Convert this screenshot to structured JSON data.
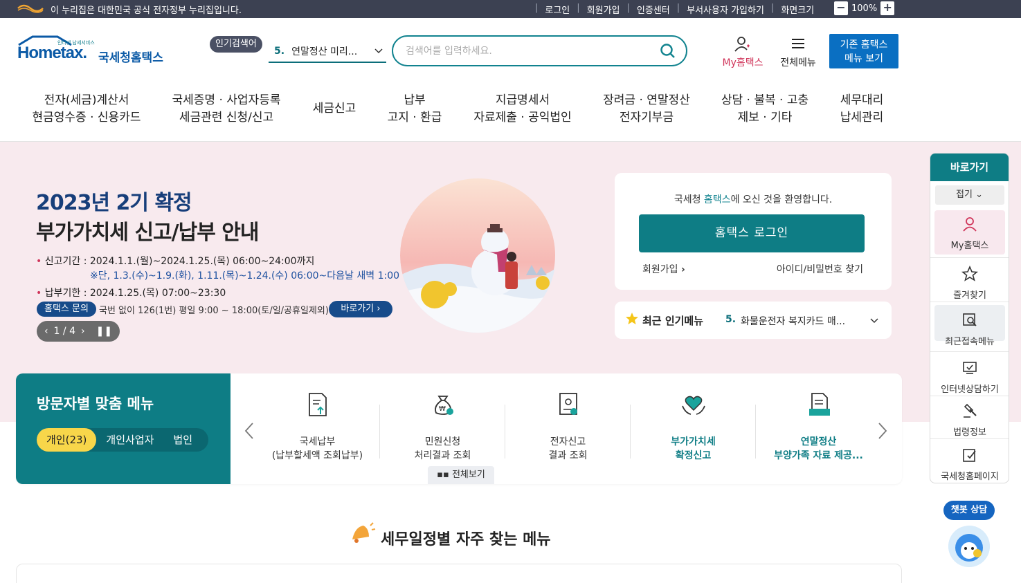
{
  "gov_bar": {
    "notice": "이 누리집은 대한민국 공식 전자정부 누리집입니다.",
    "links": [
      "로그인",
      "회원가입",
      "인증센터",
      "부서사용자 가입하기",
      "화면크기"
    ],
    "zoom_minus": "−",
    "zoom_value": "100%",
    "zoom_plus": "+"
  },
  "brand": {
    "tagline": "인터넷 납세서비스",
    "logo_text": "Hometax.",
    "name": "국세청홈택스"
  },
  "popular_search": {
    "tag": "인기검색어",
    "rank": "5.",
    "term": "연말정산 미리..."
  },
  "search": {
    "placeholder": "검색어를 입력하세요."
  },
  "header_actions": {
    "my_hometax": "My홈택스",
    "all_menu": "전체메뉴",
    "legacy_line1": "기존 홈택스",
    "legacy_line2": "메뉴 보기"
  },
  "main_nav": [
    {
      "line1": "전자(세금)계산서",
      "line2": "현금영수증 · 신용카드"
    },
    {
      "line1": "국세증명 · 사업자등록",
      "line2": "세금관련 신청/신고"
    },
    {
      "line1": "세금신고",
      "line2": ""
    },
    {
      "line1": "납부",
      "line2": "고지 · 환급"
    },
    {
      "line1": "지급명세서",
      "line2": "자료제출 · 공익법인"
    },
    {
      "line1": "장려금 · 연말정산",
      "line2": "전자기부금"
    },
    {
      "line1": "상담 · 불복 · 고충",
      "line2": "제보 · 기타"
    },
    {
      "line1": "세무대리",
      "line2": "납세관리"
    }
  ],
  "hero": {
    "title_line1": "2023년 2기 확정",
    "title_line2": "부가가치세 신고/납부 안내",
    "period_label": "신고기간 : ",
    "period_value": "2024.1.1.(월)~2024.1.25.(목) 06:00~24:00까지",
    "period_note": "※단, 1.3.(수)~1.9.(화), 1.11.(목)~1.24.(수) 06:00~다음날 새벽 1:00",
    "payment_label": "납부기한 : ",
    "payment_value": "2024.1.25.(목) 07:00~23:30",
    "inquiry_badge": "홈택스 문의",
    "inquiry_text": "국번 없이 126(1번) 평일 9:00 ~ 18:00(토/일/공휴일제외)",
    "goto_button": "바로가기",
    "pager": "1 / 4"
  },
  "login_card": {
    "welcome_pre": "국세청 ",
    "welcome_hl": "홈택스",
    "welcome_post": "에 오신 것을 환영합니다.",
    "login_button": "홈택스 로그인",
    "join_link": "회원가입",
    "find_link": "아이디/비밀번호 찾기"
  },
  "recent_popular": {
    "title": "최근 인기메뉴",
    "rank": "5.",
    "item": "화물운전자 복지카드 매..."
  },
  "visitor_menu": {
    "title": "방문자별 맞춤 메뉴",
    "tabs": [
      "개인(23)",
      "개인사업자",
      "법인"
    ],
    "items": [
      {
        "line1": "국세납부",
        "line2": "(납부할세액 조회납부)"
      },
      {
        "line1": "민원신청",
        "line2": "처리결과 조회"
      },
      {
        "line1": "전자신고",
        "line2": "결과 조회"
      },
      {
        "line1": "부가가치세",
        "line2": "확정신고"
      },
      {
        "line1": "연말정산",
        "line2": "부양가족 자료 제공..."
      }
    ],
    "view_all": "전체보기"
  },
  "schedule": {
    "title": "세무일정별 자주 찾는 메뉴"
  },
  "quick_panel": {
    "title": "바로가기",
    "fold": "접기",
    "items": [
      "My홈택스",
      "즐겨찾기",
      "최근접속메뉴",
      "인터넷상담하기",
      "법령정보",
      "국세청홈페이지"
    ]
  },
  "chatbot": {
    "label": "챗봇 상담"
  },
  "colors": {
    "teal": "#0e7d85",
    "navy": "#173e7a",
    "hero_bg": "#f8eaee",
    "gov_bar": "#3c4152",
    "accent_pink": "#d0355a",
    "tab_active": "#f8d64a"
  }
}
